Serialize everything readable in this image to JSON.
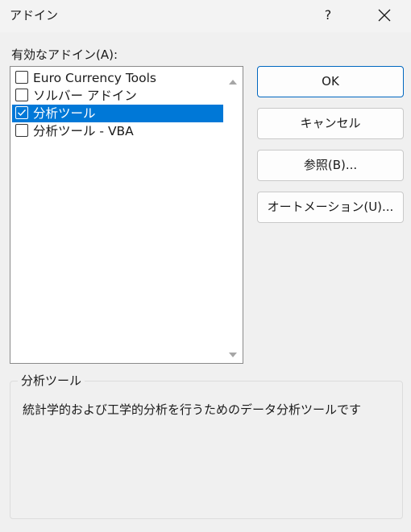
{
  "window": {
    "title": "アドイン",
    "help_label": "?"
  },
  "addins": {
    "label": "有効なアドイン(A):",
    "items": [
      {
        "label": "Euro Currency Tools",
        "checked": false,
        "selected": false
      },
      {
        "label": "ソルバー アドイン",
        "checked": false,
        "selected": false
      },
      {
        "label": "分析ツール",
        "checked": true,
        "selected": true
      },
      {
        "label": "分析ツール - VBA",
        "checked": false,
        "selected": false
      }
    ]
  },
  "buttons": {
    "ok": "OK",
    "cancel": "キャンセル",
    "browse": "参照(B)...",
    "automation": "オートメーション(U)..."
  },
  "description": {
    "title": "分析ツール",
    "text": "統計学的および工学的分析を行うためのデータ分析ツールです"
  },
  "colors": {
    "selection": "#0078d7",
    "default_button_border": "#0067c0"
  }
}
